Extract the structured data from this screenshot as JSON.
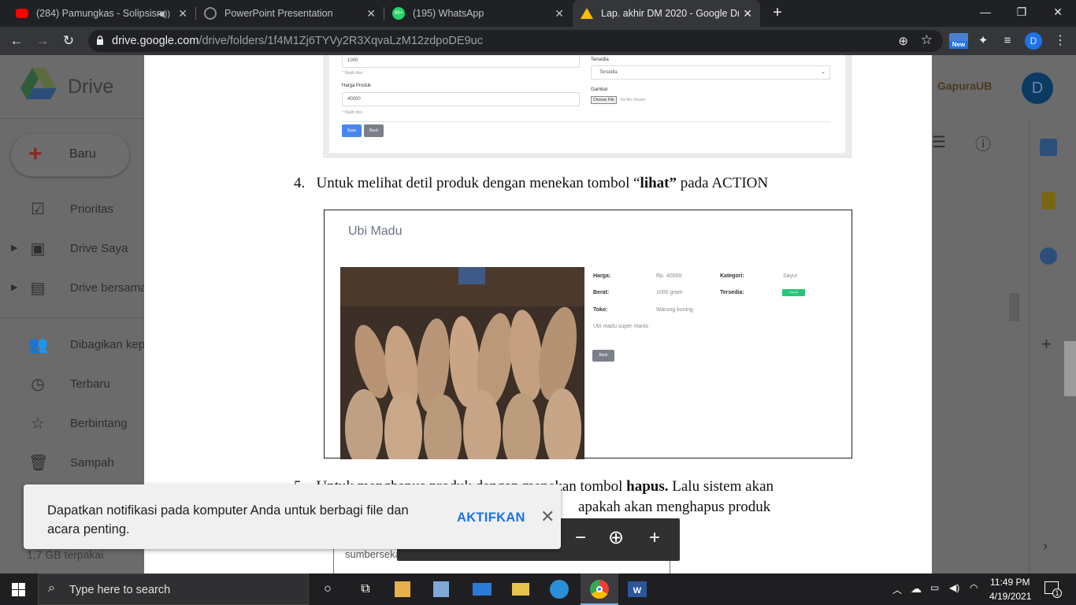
{
  "tabs": [
    {
      "title": "(284) Pamungkas - Solipsism",
      "favicon": "youtube-icon",
      "color": "#ff0000"
    },
    {
      "title": "PowerPoint Presentation",
      "favicon": "globe-icon",
      "color": "#8a8d91"
    },
    {
      "title": "(195) WhatsApp",
      "favicon": "whatsapp-icon",
      "color": "#25d366",
      "badge": "99+"
    },
    {
      "title": "Lap. akhir DM 2020 - Google Drive",
      "favicon": "drive-icon",
      "color": "#fbbc04"
    }
  ],
  "browser": {
    "url_host": "drive.google.com",
    "url_path": "/drive/folders/1f4M1Zj6TYVy2R3XqvaLzM12zdpoDE9uc",
    "ext_badge": "New",
    "profile_letter": "D"
  },
  "drive": {
    "app_name": "Drive",
    "new_button": "Baru",
    "nav": [
      {
        "label": "Prioritas",
        "icon": "check-box-icon"
      },
      {
        "label": "Drive Saya",
        "icon": "my-drive-icon"
      },
      {
        "label": "Drive bersama",
        "icon": "shared-drives-icon"
      },
      {
        "label": "Dibagikan kepada saya",
        "icon": "people-icon"
      },
      {
        "label": "Terbaru",
        "icon": "clock-icon"
      },
      {
        "label": "Berbintang",
        "icon": "star-icon"
      },
      {
        "label": "Sampah",
        "icon": "trash-icon"
      }
    ],
    "storage": "1,7 GB terpakai",
    "org_name": "GapuraUB",
    "avatar_letter": "D"
  },
  "document": {
    "form": {
      "berat_value": "1000",
      "required_hint": "* Wajib diisi.",
      "harga_label": "Harga Produk",
      "harga_value": "40000",
      "tersedia_label": "Tersedia",
      "tersedia_value": "Tersedia",
      "gambar_label": "Gambar",
      "choose_file": "Choose File",
      "no_file": "No file chosen",
      "save": "Save",
      "back": "Back"
    },
    "step4_number": "4.",
    "step4_pre": "Untuk melihat detil produk dengan menekan tombol “",
    "step4_bold": "lihat”",
    "step4_post": " pada ACTION",
    "detail": {
      "title": "Ubi Madu",
      "harga_label": "Harga:",
      "harga_value": "Rp. 40000",
      "kategori_label": "Kategori:",
      "kategori_value": "Sayur",
      "berat_label": "Berat:",
      "berat_value": "1000 gram",
      "tersedia_label": "Tersedia:",
      "tersedia_value": "Tersedia",
      "toko_label": "Toko:",
      "toko_value": "Warung kuning",
      "description": "Ubi madu super manis",
      "back": "Back"
    },
    "step5_line1_pre": "Untuk menghapus produk dengan menekan tombol ",
    "step5_line1_bold": "hapus.",
    "step5_line1_post": " Lalu sistem akan",
    "step5_line2": "apakah akan menghapus produk",
    "dialog_site": "sumbersekar-mart.com says"
  },
  "toast": {
    "message": "Dapatkan notifikasi pada komputer Anda untuk berbagi file dan acara penting.",
    "action": "AKTIFKAN"
  },
  "taskbar": {
    "search_placeholder": "Type here to search",
    "time": "11:49 PM",
    "date": "4/19/2021",
    "notification_count": "1"
  }
}
